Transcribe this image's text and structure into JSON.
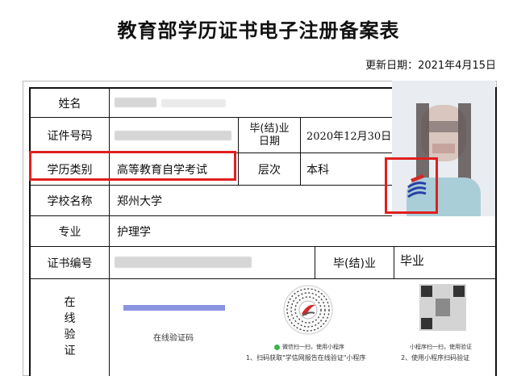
{
  "title": "教育部学历证书电子注册备案表",
  "update_date": "更新日期：2021年4月15日",
  "labels": {
    "name": "姓名",
    "id_number": "证件号码",
    "graduation_date": "毕(结)业\n日期",
    "study_type": "学历类别",
    "level": "层次",
    "school": "学校名称",
    "major": "专业",
    "cert_number": "证书编号",
    "grad_status": "毕(结)业",
    "online_verify": "在\n线\n验\n证"
  },
  "values": {
    "graduation_date": "2020年12月30日",
    "study_type": "高等教育自学考试",
    "level": "本科",
    "school": "郑州大学",
    "major": "护理学",
    "grad_status": "毕业"
  },
  "verify": {
    "code_label": "在线验证码",
    "wechat_caption": "微信扫一扫，使用小程序",
    "wechat_step": "1、扫码获取\"学信网报告在线验证\"小程序",
    "miniapp_caption": "小程序扫一扫，使用验证",
    "miniapp_step": "2、使用小程序扫码验证"
  },
  "colors": {
    "highlight": "#e01f1f",
    "code_bar": "#8a94e0"
  },
  "icons": {
    "wechat": "wechat-icon",
    "miniapp": "wechat-miniprogram-code",
    "seal": "chsi-logo-icon"
  }
}
